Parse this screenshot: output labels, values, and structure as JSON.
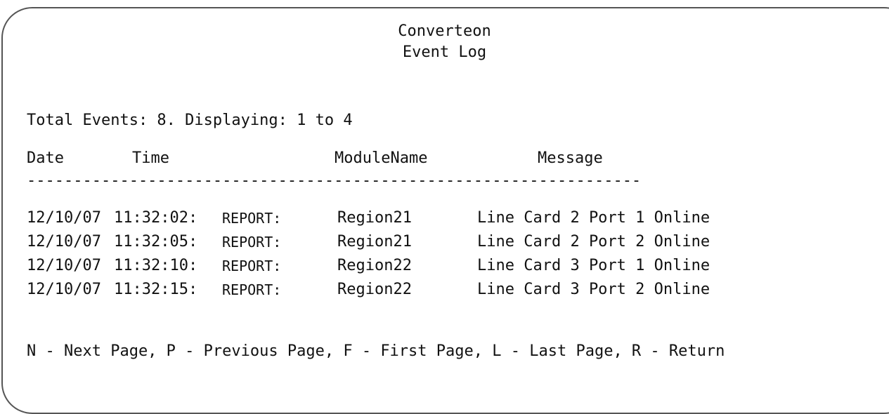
{
  "header": {
    "product": "Converteon",
    "title": "Event Log"
  },
  "summary": "Total Events: 8. Displaying: 1 to 4",
  "columns": {
    "date": "Date",
    "time": "Time",
    "module": "ModuleName",
    "message": "Message"
  },
  "separator": "------------------------------------------------------------------",
  "events": [
    {
      "date": "12/10/07",
      "time": "11:32:02:",
      "level": "REPORT:",
      "module": "Region21",
      "message": "Line Card 2 Port 1 Online"
    },
    {
      "date": "12/10/07",
      "time": "11:32:05:",
      "level": "REPORT:",
      "module": "Region21",
      "message": "Line Card 2 Port 2 Online"
    },
    {
      "date": "12/10/07",
      "time": "11:32:10:",
      "level": "REPORT:",
      "module": "Region22",
      "message": "Line Card 3 Port 1 Online"
    },
    {
      "date": "12/10/07",
      "time": "11:32:15:",
      "level": "REPORT:",
      "module": "Region22",
      "message": "Line Card 3 Port 2 Online"
    }
  ],
  "footer": "N - Next Page, P - Previous Page, F - First Page, L - Last Page, R - Return"
}
